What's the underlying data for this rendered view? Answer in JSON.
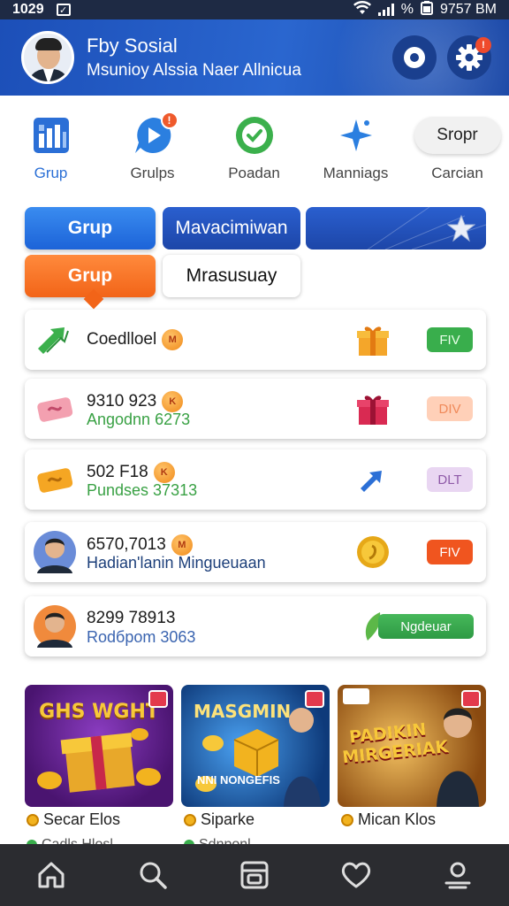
{
  "status_bar": {
    "time": "1029",
    "battery": "%",
    "clock": "9757 BM"
  },
  "header": {
    "title": "Fby Sosial",
    "subtitle": "Msunioy Alssia Naer Allnicua",
    "settings_badge": "!"
  },
  "quick_nav": [
    {
      "label": "Grup",
      "icon": "grid-chart-icon",
      "active": true
    },
    {
      "label": "Grulps",
      "icon": "play-chat-icon",
      "badge": "!"
    },
    {
      "label": "Poadan",
      "icon": "check-circle-icon"
    },
    {
      "label": "Manniags",
      "icon": "star-sparkle-icon"
    },
    {
      "label": "Carcian",
      "button": "Sropr"
    }
  ],
  "tabs": {
    "row1": [
      "Grup",
      "Mavacimiwan"
    ],
    "row2": [
      "Grup",
      "Mrasusuay"
    ]
  },
  "list": [
    {
      "title": "Coedlloel",
      "subtitle": "",
      "action": "FIV",
      "tag": "M"
    },
    {
      "title": "9310 923",
      "subtitle": "Angodnn 6273",
      "action": "DIV",
      "tag": "K"
    },
    {
      "title": "502 F18",
      "subtitle": "Pundses 37313",
      "action": "DLT",
      "tag": "K"
    },
    {
      "title": "6570,7013",
      "subtitle": "Hadian'lanin Mingueuaan",
      "action": "FIV",
      "tag": "M"
    },
    {
      "title": "8299 78913",
      "subtitle": "Rodбpom 3063",
      "action": "Ngdeuar"
    }
  ],
  "promos": [
    {
      "title": "GHS WGHT",
      "caption": "Secar Elos",
      "caption2": "Cadls Hlosl"
    },
    {
      "title": "MASGMIN",
      "banner": "NNI NONGEFIS",
      "caption": "Siparke",
      "caption2": "Sdnponl"
    },
    {
      "title": "PADIKIN MIRGERIAK",
      "caption": "Mican Klos"
    }
  ],
  "colors": {
    "header_blue": "#1c4fb8",
    "accent_blue": "#2a6fd6",
    "accent_orange": "#f26418",
    "action_green": "#39ae4c",
    "nav_dark": "#2b2c30"
  }
}
